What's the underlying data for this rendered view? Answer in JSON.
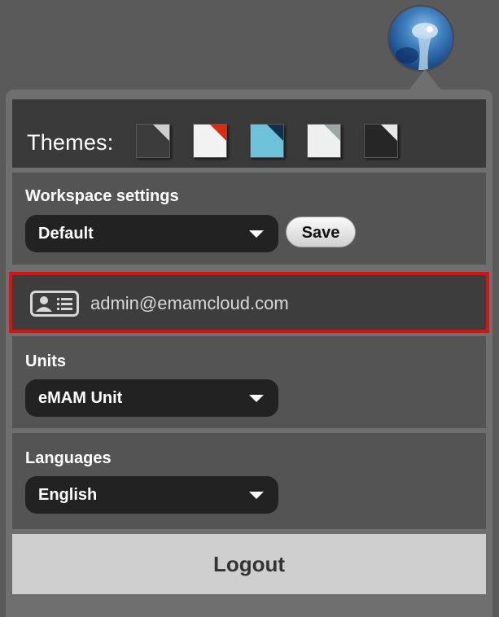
{
  "themes": {
    "label": "Themes:",
    "swatches": [
      {
        "name": "dark-grey",
        "base": "#3c3c3c",
        "corner": "#cfcfcf"
      },
      {
        "name": "red",
        "base": "#f2f2f2",
        "corner": "#e02a10"
      },
      {
        "name": "cyan",
        "base": "#6ec2da",
        "corner": "#123048"
      },
      {
        "name": "light",
        "base": "#eef0f0",
        "corner": "#9aa8a8"
      },
      {
        "name": "black",
        "base": "#262626",
        "corner": "#e8e8e8"
      }
    ]
  },
  "workspace": {
    "title": "Workspace settings",
    "selected": "Default",
    "save_label": "Save"
  },
  "user": {
    "email": "admin@emamcloud.com"
  },
  "units": {
    "title": "Units",
    "selected": "eMAM Unit"
  },
  "languages": {
    "title": "Languages",
    "selected": "English"
  },
  "logout_label": "Logout",
  "colors": {
    "highlight": "#e01010",
    "panel": "#6f6f6f",
    "section": "#545454",
    "dropdown": "#222222"
  }
}
